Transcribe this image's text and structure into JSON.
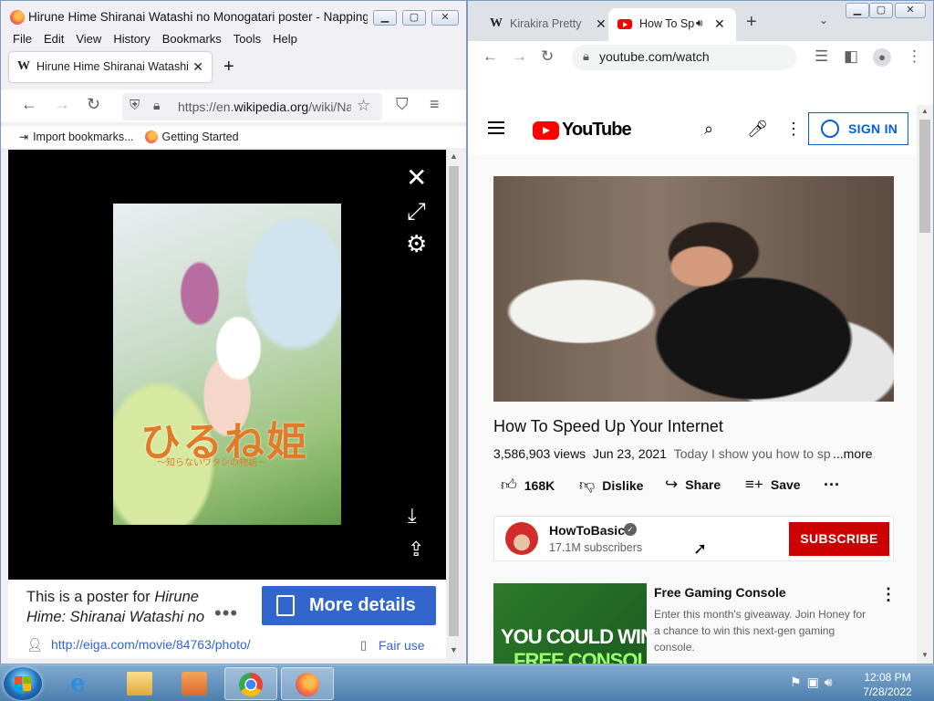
{
  "firefox": {
    "window_title": "Hirune Hime Shiranai Watashi no Monogatari poster - Napping Princ...",
    "menu": [
      "File",
      "Edit",
      "View",
      "History",
      "Bookmarks",
      "Tools",
      "Help"
    ],
    "tab_title": "Hirune Hime Shiranai Watashi no Monogatari poster",
    "tab_favicon": "W",
    "url_prefix": "https://en.",
    "url_domain": "wikipedia.org",
    "url_rest": "/wiki/Napping_Princess",
    "bookmarks": [
      "Import bookmarks...",
      "Getting Started"
    ],
    "poster_title_jp": "ひるね姫",
    "poster_subtitle_jp": "〜知らないワタシの物語〜",
    "caption": "This is a poster for Hirune Hime: Shiranai Watashi no",
    "caption_plain": "This is a poster for ",
    "caption_italic": "Hirune Hime: Shiranai Watashi no",
    "caption_more": "•••",
    "more_details": "More details",
    "source_link": "http://eiga.com/movie/84763/photo/",
    "fair_use": "Fair use"
  },
  "chrome": {
    "tabs": [
      {
        "favicon": "W",
        "title": "Kirakira Pretty"
      },
      {
        "favicon": "youtube-icon",
        "title": "How To Sp"
      }
    ],
    "url": "youtube.com/watch",
    "youtube": {
      "logo_word": "YouTube",
      "sign_in": "SIGN IN",
      "video_title": "How To Speed Up Your Internet",
      "views": "3,586,903 views",
      "date": "Jun 23, 2021",
      "description": "Today I show you how to sp",
      "more": "...more",
      "likes": "168K",
      "dislike": "Dislike",
      "share": "Share",
      "save": "Save",
      "channel_name": "HowToBasic",
      "subscribers": "17.1M subscribers",
      "subscribe": "SUBSCRIBE",
      "ad_title": "Free Gaming Console",
      "ad_body": "Enter this month's giveaway. Join Honey for a chance to win this next-gen gaming console.",
      "ad_thumb_line1": "YOU COULD WIN A",
      "ad_thumb_line2": "FREE CONSOLE"
    }
  },
  "taskbar": {
    "time": "12:08 PM",
    "date": "7/28/2022"
  },
  "colors": {
    "youtube_red": "#ff0000",
    "subscribe_red": "#cc0000",
    "wiki_blue": "#3366cc",
    "link_blue": "#065fd4"
  }
}
